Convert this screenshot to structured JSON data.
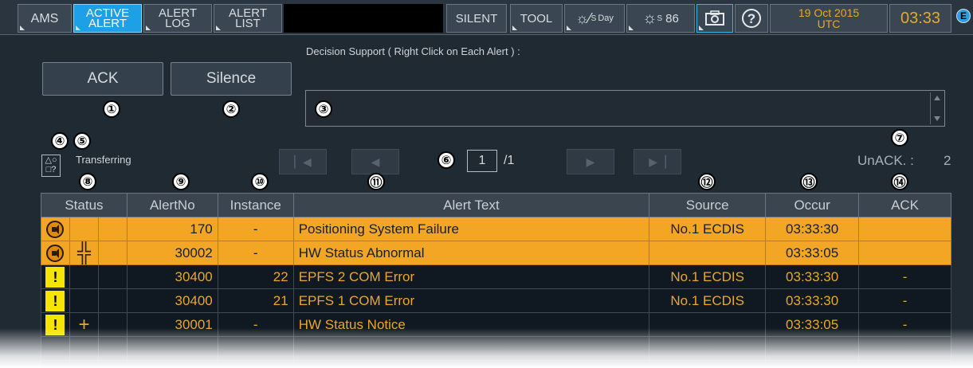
{
  "topbar": {
    "ams": "AMS",
    "active_alert": [
      "ACTIVE",
      "ALERT"
    ],
    "alert_log": [
      "ALERT",
      "LOG"
    ],
    "alert_list": [
      "ALERT",
      "LIST"
    ],
    "silent": "SILENT",
    "tool": "TOOL",
    "day_mode": "Day",
    "day_sub": "S",
    "brightness_sub": "S",
    "brightness": "86",
    "date": "19 Oct 2015",
    "tz": "UTC",
    "time": "03:33",
    "badge": "E"
  },
  "controls": {
    "ack_label": "ACK",
    "silence_label": "Silence",
    "decision_support_label": "Decision Support ( Right Click on Each Alert ) :",
    "transferring": "Transferring",
    "status_icon_glyphs": "△○\n□?",
    "page_current": "1",
    "page_total": "/1",
    "unack_label": "UnACK. :",
    "unack_count": "2"
  },
  "callouts": [
    "①",
    "②",
    "③",
    "④",
    "⑤",
    "⑥",
    "⑦",
    "⑧",
    "⑨",
    "⑩",
    "⑪",
    "⑫",
    "⑬",
    "⑭"
  ],
  "table": {
    "headers": [
      "Status",
      "AlertNo",
      "Instance",
      "Alert Text",
      "Source",
      "Occur",
      "ACK"
    ],
    "rows": [
      {
        "icon": "speaker-icon",
        "mark": "",
        "alert_no": "170",
        "instance": "-",
        "text": "Positioning System Failure",
        "source": "No.1 ECDIS",
        "occur": "03:33:30",
        "ack": "",
        "state": "unacked"
      },
      {
        "icon": "speaker-icon",
        "mark": "╬",
        "alert_no": "30002",
        "instance": "-",
        "text": "HW Status Abnormal",
        "source": "",
        "occur": "03:33:05",
        "ack": "",
        "state": "unacked"
      },
      {
        "icon": "warning-icon",
        "mark": "",
        "alert_no": "30400",
        "instance": "22",
        "text": "EPFS 2 COM Error",
        "source": "No.1 ECDIS",
        "occur": "03:33:30",
        "ack": "-",
        "state": "acked"
      },
      {
        "icon": "warning-icon",
        "mark": "",
        "alert_no": "30400",
        "instance": "21",
        "text": "EPFS 1 COM Error",
        "source": "No.1 ECDIS",
        "occur": "03:33:30",
        "ack": "-",
        "state": "acked"
      },
      {
        "icon": "warning-icon",
        "mark": "+",
        "alert_no": "30001",
        "instance": "-",
        "text": "HW Status Notice",
        "source": "",
        "occur": "03:33:05",
        "ack": "-",
        "state": "acked"
      }
    ]
  },
  "colors": {
    "unacked_row": "#f2a623",
    "acked_text": "#e8a72c",
    "active_tab": "#1ea0e6",
    "warning": "#f5e400"
  }
}
